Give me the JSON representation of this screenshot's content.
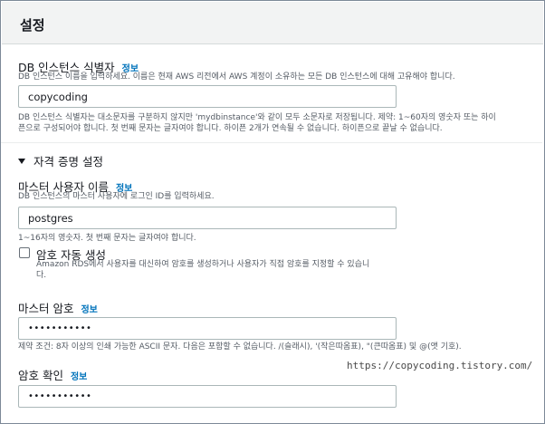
{
  "panel": {
    "title": "설정"
  },
  "db_identifier": {
    "label": "DB 인스턴스 식별자",
    "info": "정보",
    "description": "DB 인스턴스 이름을 입력하세요. 이름은 현재 AWS 리전에서 AWS 계정이 소유하는 모든 DB 인스턴스에 대해 고유해야 합니다.",
    "value": "copycoding",
    "constraint_line1": "DB 인스턴스 식별자는 대소문자를 구분하지 않지만 'mydbinstance'와 같이 모두 소문자로 저장됩니다. 제약: 1~60자의 영숫자 또는 하이",
    "constraint_line2": "픈으로 구성되어야 합니다. 첫 번째 문자는 글자여야 합니다. 하이픈 2개가 연속될 수 없습니다. 하이픈으로 끝날 수 없습니다."
  },
  "credentials_section": {
    "title": "자격 증명 설정",
    "expanded": true
  },
  "master_username": {
    "label": "마스터 사용자 이름",
    "info": "정보",
    "description": "DB 인스턴스의 마스터 사용자에 로그인 ID를 입력하세요.",
    "value": "postgres",
    "constraint": "1~16자의 영숫자. 첫 번째 문자는 글자여야 합니다."
  },
  "auto_password": {
    "label": "암호 자동 생성",
    "checked": false,
    "description_line1": "Amazon RDS에서 사용자를 대신하여 암호를 생성하거나 사용자가 직접 암호를 지정할 수 있습니",
    "description_line2": "다."
  },
  "master_password": {
    "label": "마스터 암호",
    "info": "정보",
    "value": "•••••••••••",
    "constraint": "제약 조건: 8자 이상의 인쇄 가능한 ASCII 문자. 다음은 포함할 수 없습니다. /(슬래시), '(작은따옴표), \"(큰따옴표) 및 @(앳 기호)."
  },
  "confirm_password": {
    "label": "암호 확인",
    "info": "정보",
    "value": "•••••••••••"
  },
  "watermark": "https://copycoding.tistory.com/"
}
